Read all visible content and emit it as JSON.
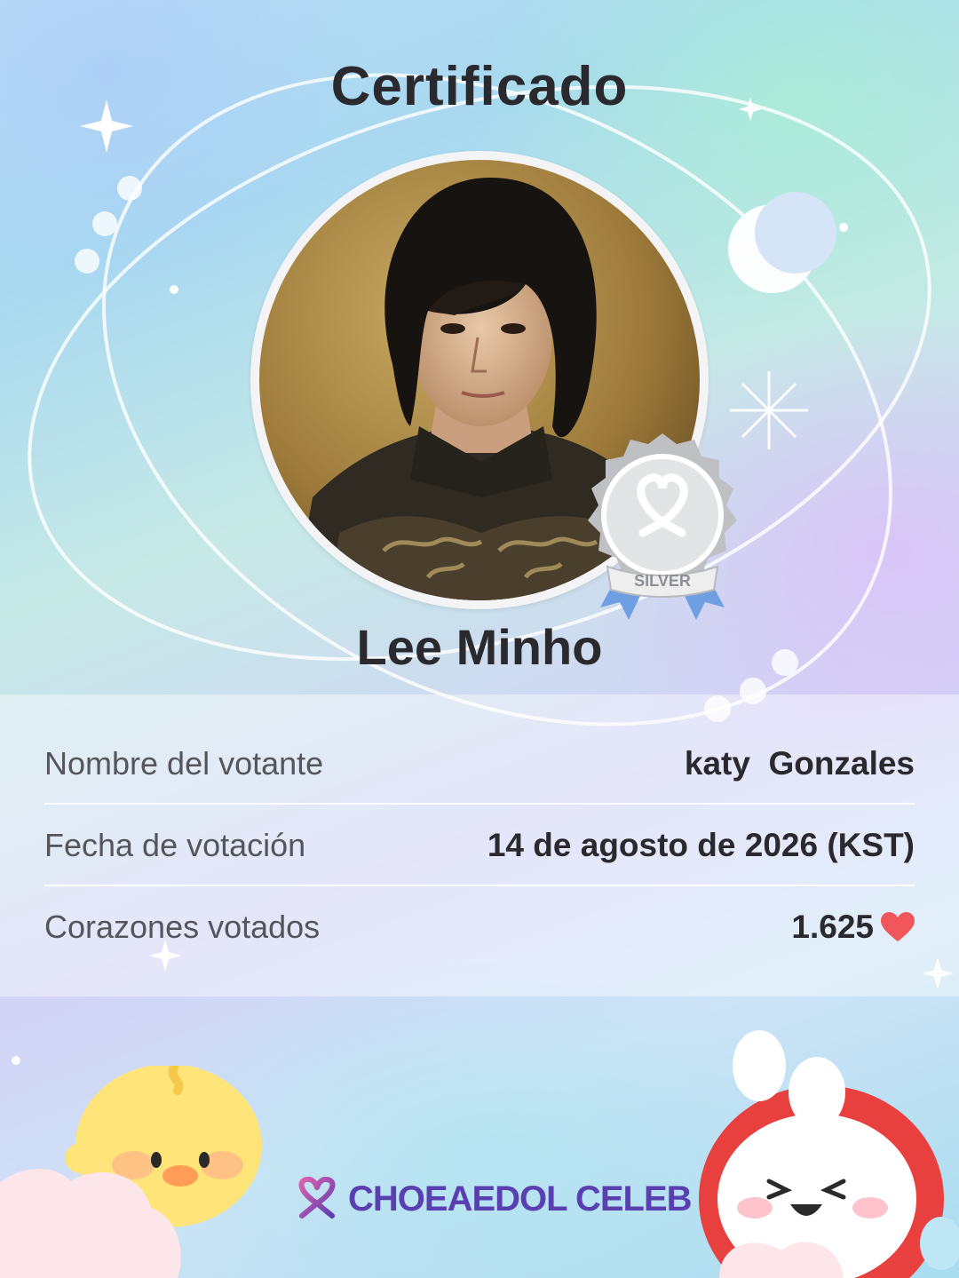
{
  "certificate": {
    "title": "Certificado",
    "celebrity_name": "Lee Minho",
    "badge_label": "SILVER",
    "badge_level": "silver"
  },
  "details": [
    {
      "label": "Nombre del votante",
      "value": "katy  Gonzales"
    },
    {
      "label": "Fecha de votación",
      "value": "14 de agosto de 2026 (KST)"
    },
    {
      "label": "Corazones votados",
      "value": "1.625"
    }
  ],
  "icons": {
    "heart": "heart-icon",
    "brand_logo": "choeaedol-logo-icon",
    "moon": "crescent-moon-icon"
  },
  "brand": {
    "name": "CHOEAEDOL CELEB"
  },
  "colors": {
    "heart": "#f0565a",
    "brand": "#5a3fb0",
    "badge_silver": "#c8c9cc",
    "ribbon": "#6f9fe3"
  }
}
